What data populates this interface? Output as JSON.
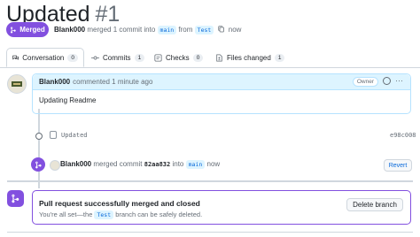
{
  "header": {
    "title": "Updated",
    "number": "#1"
  },
  "merge_status": {
    "badge": "Merged",
    "author": "Blank000",
    "text_a": "merged 1 commit into",
    "base": "main",
    "text_b": "from",
    "head": "Test",
    "time": "now"
  },
  "tabs": [
    {
      "label": "Conversation",
      "count": "0"
    },
    {
      "label": "Commits",
      "count": "1"
    },
    {
      "label": "Checks",
      "count": "0"
    },
    {
      "label": "Files changed",
      "count": "1"
    }
  ],
  "comment": {
    "author": "Blank000",
    "meta": "commented 1 minute ago",
    "role": "Owner",
    "kebab": "···",
    "body": "Updating Readme"
  },
  "commit": {
    "message": "Updated",
    "sha": "e98c008"
  },
  "merge_event": {
    "author": "Blank000",
    "text_a": "merged commit",
    "sha": "82aa832",
    "text_b": "into",
    "branch": "main",
    "time": "now",
    "revert": "Revert"
  },
  "status": {
    "title": "Pull request successfully merged and closed",
    "sub_a": "You're all set—the",
    "branch": "Test",
    "sub_b": "branch can be safely deleted.",
    "delete": "Delete branch"
  },
  "colors": {
    "merged": "#8250df",
    "link": "#0969da",
    "highlight": "#ddf4ff"
  }
}
